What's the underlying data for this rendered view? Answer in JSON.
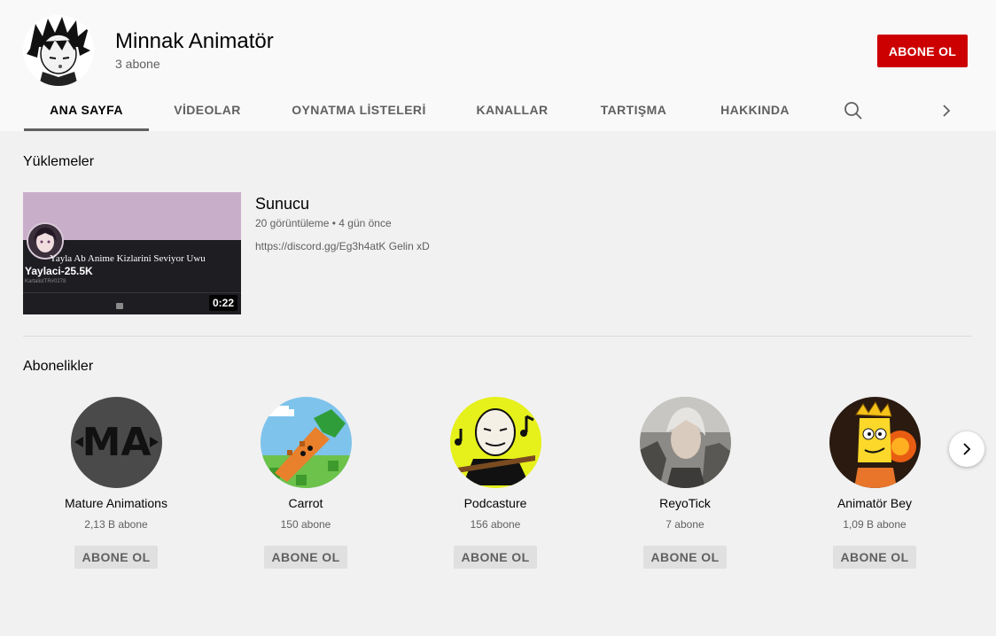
{
  "channel": {
    "name": "Minnak Animatör",
    "subscribers": "3 abone",
    "subscribe_label": "ABONE OL"
  },
  "tabs": [
    {
      "label": "ANA SAYFA",
      "active": true
    },
    {
      "label": "VİDEOLAR"
    },
    {
      "label": "OYNATMA LİSTELERİ"
    },
    {
      "label": "KANALLAR"
    },
    {
      "label": "TARTIŞMA"
    },
    {
      "label": "HAKKINDA"
    }
  ],
  "tab_icons": {
    "search": "search-icon",
    "next": "chevron-right-icon"
  },
  "uploads": {
    "heading": "Yüklemeler",
    "video": {
      "title": "Sunucu",
      "meta": "20 görüntüleme • 4 gün önce",
      "description": "https://discord.gg/Eg3h4atK Gelin xD",
      "duration": "0:22",
      "thumb_line1": "Yayla Ab Anime Kizlarini Seviyor Uwu",
      "thumb_line2": "Yaylaci-25.5K",
      "thumb_line3": "KartalistTR#0278"
    }
  },
  "subscriptions": {
    "heading": "Abonelikler",
    "items": [
      {
        "name": "Mature Animations",
        "count": "2,13 B abone",
        "button": "ABONE OL",
        "avatar_text": "MA"
      },
      {
        "name": "Carrot",
        "count": "150 abone",
        "button": "ABONE OL"
      },
      {
        "name": "Podcasture",
        "count": "156 abone",
        "button": "ABONE OL"
      },
      {
        "name": "ReyoTick",
        "count": "7 abone",
        "button": "ABONE OL"
      },
      {
        "name": "Animatör Bey",
        "count": "1,09 B abone",
        "button": "ABONE OL"
      }
    ],
    "next_icon": "chevron-right-icon"
  },
  "colors": {
    "subscribe_red": "#cc0000",
    "page_bg": "#f1f1f1",
    "header_bg": "#f9f9f9"
  }
}
